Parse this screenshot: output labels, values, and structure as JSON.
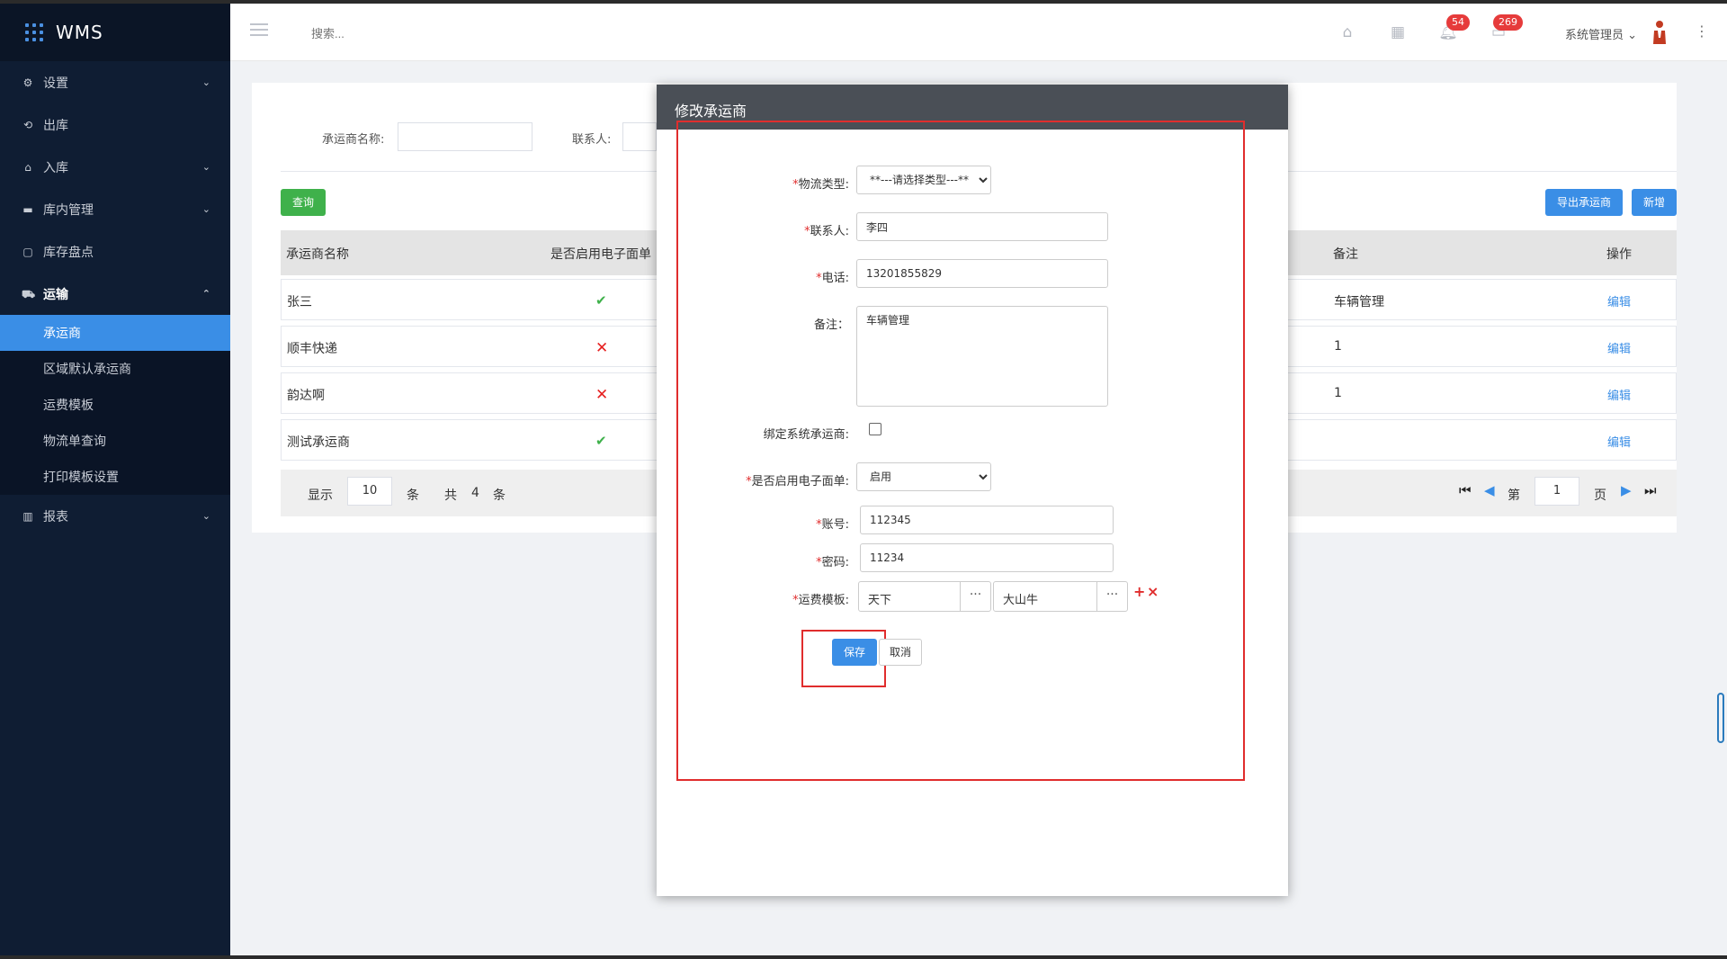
{
  "app": {
    "logo": "WMS"
  },
  "sidebar": {
    "items": [
      {
        "label": "设置",
        "icon": "gear-icon"
      },
      {
        "label": "出库",
        "icon": "outbound-icon"
      },
      {
        "label": "入库",
        "icon": "inbound-icon"
      },
      {
        "label": "库内管理",
        "icon": "warehouse-icon"
      },
      {
        "label": "库存盘点",
        "icon": "inventory-icon"
      },
      {
        "label": "运输",
        "icon": "truck-icon"
      }
    ],
    "sub_items": [
      "承运商",
      "区域默认承运商",
      "运费模板",
      "物流单查询",
      "打印模板设置"
    ],
    "active_sub": "承运商",
    "reports": {
      "label": "报表",
      "icon": "chart-icon"
    }
  },
  "header": {
    "search_placeholder": "搜索...",
    "notifications_count": "54",
    "messages_count": "269",
    "user_name": "系统管理员"
  },
  "filters": {
    "carrier_name_label": "承运商名称:",
    "contact_label": "联系人:",
    "query_button": "查询",
    "export_button": "导出承运商",
    "add_button": "新增"
  },
  "table": {
    "columns": [
      "承运商名称",
      "是否启用电子面单",
      "备注",
      "操作"
    ],
    "rows": [
      {
        "name": "张三",
        "esheet": "yes",
        "remark": "车辆管理",
        "action": "编辑"
      },
      {
        "name": "顺丰快递",
        "esheet": "no",
        "remark": "1",
        "action": "编辑"
      },
      {
        "name": "韵达啊",
        "esheet": "no",
        "remark": "1",
        "action": "编辑"
      },
      {
        "name": "测试承运商",
        "esheet": "yes",
        "remark": "",
        "action": "编辑"
      }
    ]
  },
  "pager": {
    "show": "显示",
    "page_size": "10",
    "unit": "条",
    "total_prefix": "共",
    "total": "4",
    "total_suffix": "条",
    "page_prefix": "第",
    "page": "1",
    "page_suffix": "页"
  },
  "modal": {
    "title": "修改承运商",
    "required_mark": "*",
    "fields": {
      "logistics_type": {
        "label": "物流类型:",
        "value": "**---请选择类型---**"
      },
      "contact": {
        "label": "联系人:",
        "value": "李四"
      },
      "phone": {
        "label": "电话:",
        "value": "13201855829"
      },
      "remark": {
        "label": "备注：",
        "value": "车辆管理"
      },
      "bind_system": {
        "label": "绑定系统承运商:"
      },
      "esheet": {
        "label": "是否启用电子面单:",
        "value": "启用"
      },
      "account": {
        "label": "账号:",
        "value": "112345"
      },
      "password": {
        "label": "密码:",
        "value": "11234"
      },
      "freight_template": {
        "label": "运费模板:",
        "value1": "天下",
        "value2": "大山牛",
        "dots": "···"
      }
    },
    "add_symbol": "+",
    "remove_symbol": "×",
    "save": "保存",
    "cancel": "取消"
  },
  "colors": {
    "sidebar_bg": "#0f1d33",
    "accent": "#3a8ee6",
    "success": "#3fb14b",
    "danger": "#e62020",
    "highlight_box": "#e02d2d"
  }
}
